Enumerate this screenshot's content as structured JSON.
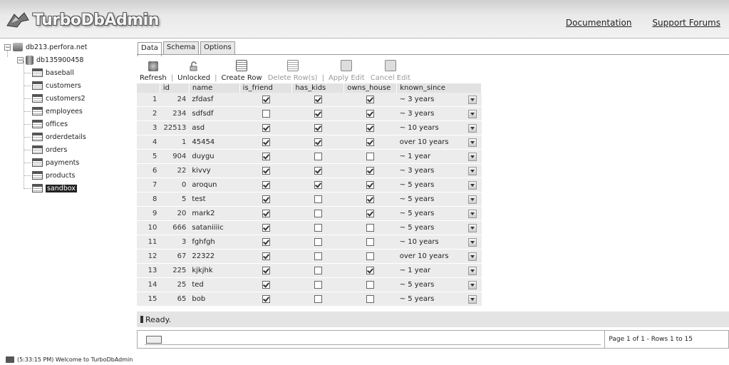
{
  "app": {
    "title": "TurboDbAdmin"
  },
  "links": {
    "documentation": "Documentation",
    "support": "Support Forums"
  },
  "tree": {
    "server": "db213.perfora.net",
    "database": "db135900458",
    "tables": [
      "baseball",
      "customers",
      "customers2",
      "employees",
      "offices",
      "orderdetails",
      "orders",
      "payments",
      "products",
      "sandbox"
    ],
    "selected": "sandbox"
  },
  "tabs": [
    {
      "label": "Data"
    },
    {
      "label": "Schema"
    },
    {
      "label": "Options"
    }
  ],
  "toolbar": {
    "refresh": "Refresh",
    "unlocked": "Unlocked",
    "create_row": "Create Row",
    "delete_rows": "Delete Row(s)",
    "apply_edit": "Apply Edit",
    "cancel_edit": "Cancel Edit"
  },
  "grid": {
    "columns": [
      "id",
      "name",
      "is_friend",
      "has_kids",
      "owns_house",
      "known_since"
    ],
    "rows": [
      {
        "n": "1",
        "id": "24",
        "name": "zfdasf",
        "is_friend": true,
        "has_kids": true,
        "owns_house": true,
        "known_since": "~ 3 years"
      },
      {
        "n": "2",
        "id": "234",
        "name": "sdfsdf",
        "is_friend": false,
        "has_kids": true,
        "owns_house": true,
        "known_since": "~ 3 years"
      },
      {
        "n": "3",
        "id": "22513",
        "name": "asd",
        "is_friend": true,
        "has_kids": true,
        "owns_house": true,
        "known_since": "~ 10 years"
      },
      {
        "n": "4",
        "id": "1",
        "name": "45454",
        "is_friend": true,
        "has_kids": true,
        "owns_house": true,
        "known_since": "over 10 years"
      },
      {
        "n": "5",
        "id": "904",
        "name": "duygu",
        "is_friend": true,
        "has_kids": false,
        "owns_house": false,
        "known_since": "~ 1 year"
      },
      {
        "n": "6",
        "id": "22",
        "name": "kivvy",
        "is_friend": true,
        "has_kids": true,
        "owns_house": true,
        "known_since": "~ 3 years"
      },
      {
        "n": "7",
        "id": "0",
        "name": "aroqun",
        "is_friend": true,
        "has_kids": true,
        "owns_house": true,
        "known_since": "~ 5 years"
      },
      {
        "n": "8",
        "id": "5",
        "name": "test",
        "is_friend": true,
        "has_kids": false,
        "owns_house": true,
        "known_since": "~ 5 years"
      },
      {
        "n": "9",
        "id": "20",
        "name": "mark2",
        "is_friend": true,
        "has_kids": false,
        "owns_house": true,
        "known_since": "~ 5 years"
      },
      {
        "n": "10",
        "id": "666",
        "name": "sataniiiic",
        "is_friend": true,
        "has_kids": false,
        "owns_house": false,
        "known_since": "~ 5 years"
      },
      {
        "n": "11",
        "id": "3",
        "name": "fghfgh",
        "is_friend": true,
        "has_kids": false,
        "owns_house": false,
        "known_since": "~ 10 years"
      },
      {
        "n": "12",
        "id": "67",
        "name": "22322",
        "is_friend": true,
        "has_kids": false,
        "owns_house": false,
        "known_since": "over 10 years"
      },
      {
        "n": "13",
        "id": "225",
        "name": "kjkjhk",
        "is_friend": true,
        "has_kids": false,
        "owns_house": true,
        "known_since": "~ 1 year"
      },
      {
        "n": "14",
        "id": "25",
        "name": "ted",
        "is_friend": true,
        "has_kids": false,
        "owns_house": false,
        "known_since": "~ 5 years"
      },
      {
        "n": "15",
        "id": "65",
        "name": "bob",
        "is_friend": true,
        "has_kids": false,
        "owns_house": false,
        "known_since": "~ 5 years"
      }
    ]
  },
  "status": {
    "text": "Ready."
  },
  "pager": {
    "text": "Page 1 of 1 - Rows 1 to 15"
  },
  "footer": {
    "text": "(5:33:15 PM) Welcome to TurboDbAdmin"
  }
}
